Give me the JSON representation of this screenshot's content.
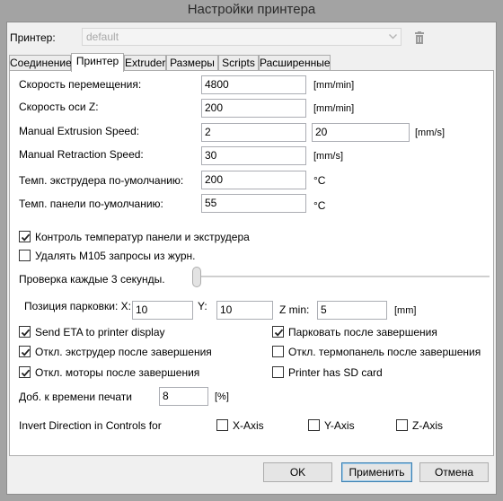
{
  "window": {
    "title": "Настройки принтера"
  },
  "printer_row": {
    "label": "Принтер:",
    "selected": "default"
  },
  "tabs": [
    {
      "label": "Соединение"
    },
    {
      "label": "Принтер"
    },
    {
      "label": "Extruder"
    },
    {
      "label": "Размеры"
    },
    {
      "label": "Scripts"
    },
    {
      "label": "Расширенные"
    }
  ],
  "fields": {
    "travel_speed": {
      "label": "Скорость перемещения:",
      "value": "4800",
      "unit": "[mm/min]"
    },
    "z_speed": {
      "label": "Скорость оси Z:",
      "value": "200",
      "unit": "[mm/min]"
    },
    "extrusion_speed": {
      "label": "Manual Extrusion Speed:",
      "value": "2",
      "value2": "20",
      "unit": "[mm/s]"
    },
    "retraction_speed": {
      "label": "Manual Retraction Speed:",
      "value": "30",
      "unit": "[mm/s]"
    },
    "extruder_temp": {
      "label": "Темп. экструдера по-умолчанию:",
      "value": "200",
      "unit": "°C"
    },
    "bed_temp": {
      "label": "Темп. панели по-умолчанию:",
      "value": "55",
      "unit": "°C"
    }
  },
  "checks": {
    "temp_control": {
      "label": "Контроль температур панели и экструдера",
      "checked": true
    },
    "remove_m105": {
      "label": "Удалять M105 запросы из журн.",
      "checked": false
    },
    "send_eta": {
      "label": "Send ETA to printer display",
      "checked": true
    },
    "park_after": {
      "label": "Парковать после завершения",
      "checked": true
    },
    "disable_extruder": {
      "label": "Откл. экструдер после завершения",
      "checked": true
    },
    "disable_bed": {
      "label": "Откл. термопанель после завершения",
      "checked": false
    },
    "disable_motors": {
      "label": "Откл. моторы после завершения",
      "checked": true
    },
    "has_sd": {
      "label": "Printer has SD card",
      "checked": false
    }
  },
  "check_interval": {
    "label": "Проверка каждые 3 секунды.",
    "level": 0
  },
  "park": {
    "label": "Позиция парковки: X:",
    "x": "10",
    "y_label": "Y:",
    "y": "10",
    "zmin_label": "Z min:",
    "zmin": "5",
    "unit": "[mm]"
  },
  "print_time": {
    "label": "Доб. к времени печати",
    "value": "8",
    "unit": "[%]"
  },
  "invert": {
    "label": "Invert Direction in Controls for",
    "x": {
      "label": "X-Axis",
      "checked": false
    },
    "y": {
      "label": "Y-Axis",
      "checked": false
    },
    "z": {
      "label": "Z-Axis",
      "checked": false
    }
  },
  "buttons": {
    "ok": "OK",
    "apply": "Применить",
    "cancel": "Отмена"
  }
}
